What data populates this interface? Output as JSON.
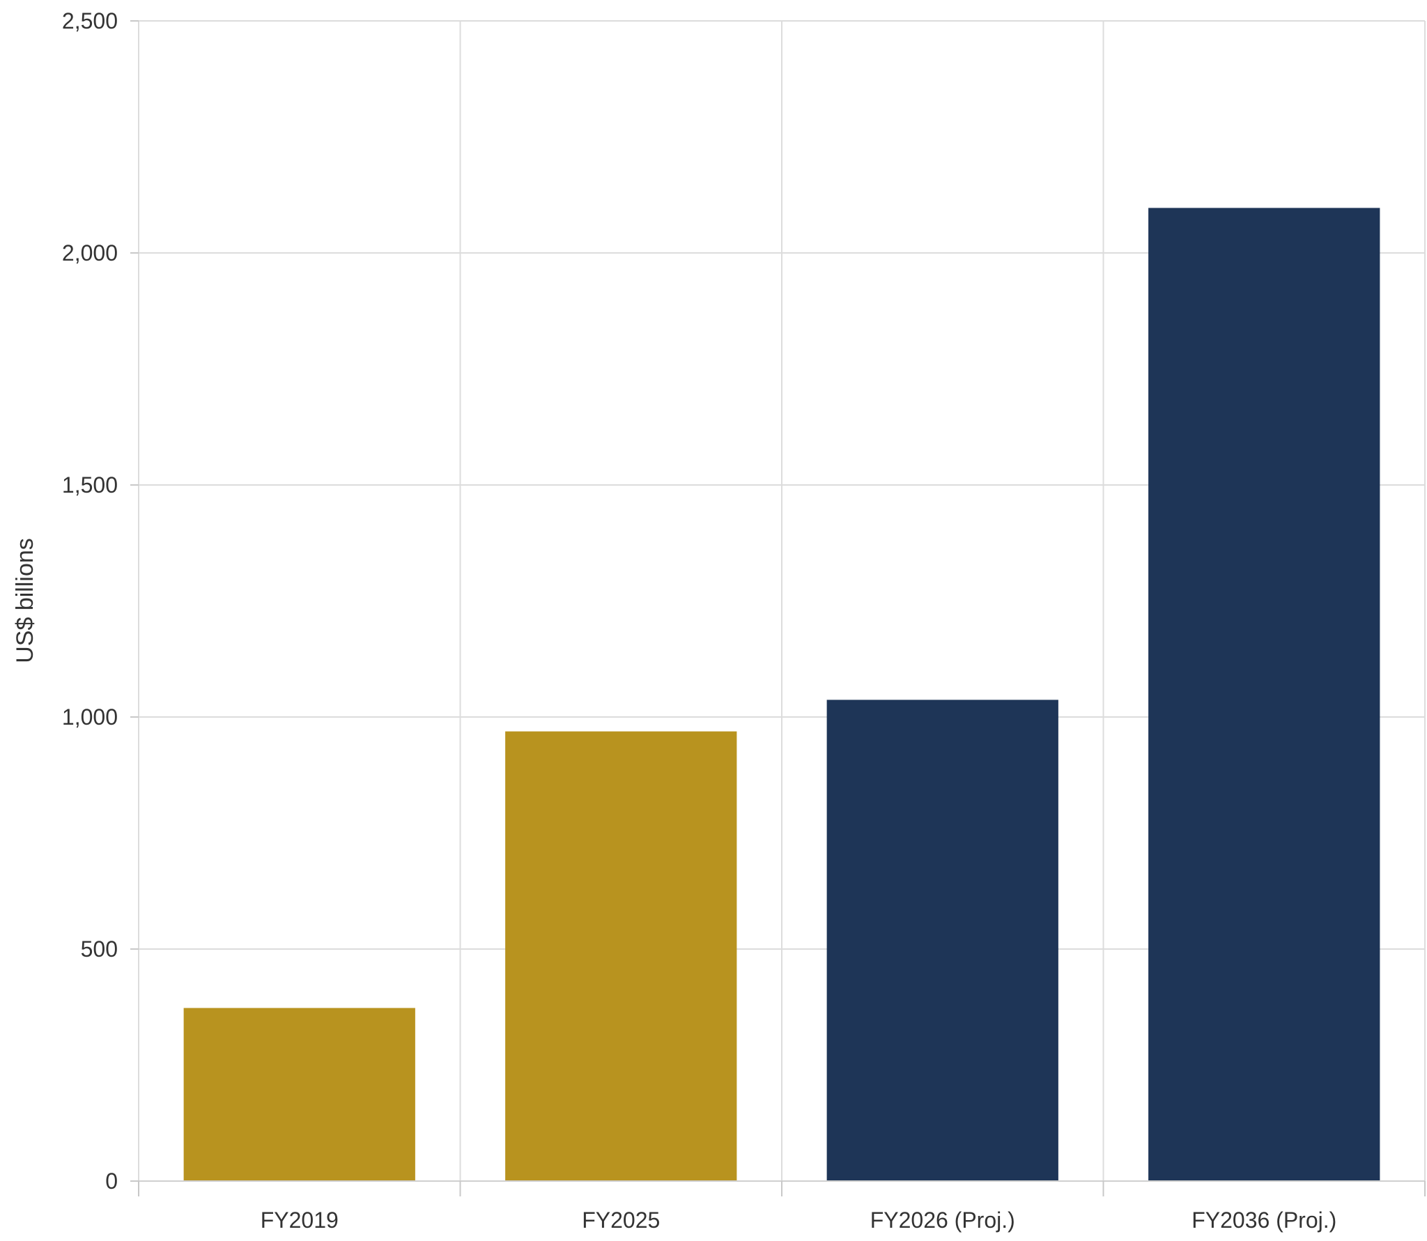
{
  "chart_data": {
    "type": "bar",
    "title": "",
    "xlabel": "",
    "ylabel": "US$ billions",
    "categories": [
      "FY2019",
      "FY2025",
      "FY2026 (Proj.)",
      "FY2036 (Proj.)"
    ],
    "values": [
      373,
      969,
      1037,
      2097
    ],
    "bar_colors": [
      "#B8931F",
      "#B8931F",
      "#1E3557",
      "#1E3557"
    ],
    "ylim": [
      0,
      2500
    ],
    "yticks": [
      0,
      500,
      1000,
      1500,
      2000,
      2500
    ],
    "ytick_labels": [
      "0",
      "500",
      "1,000",
      "1,500",
      "2,000",
      "2,500"
    ],
    "grid": true,
    "legend": "none"
  }
}
